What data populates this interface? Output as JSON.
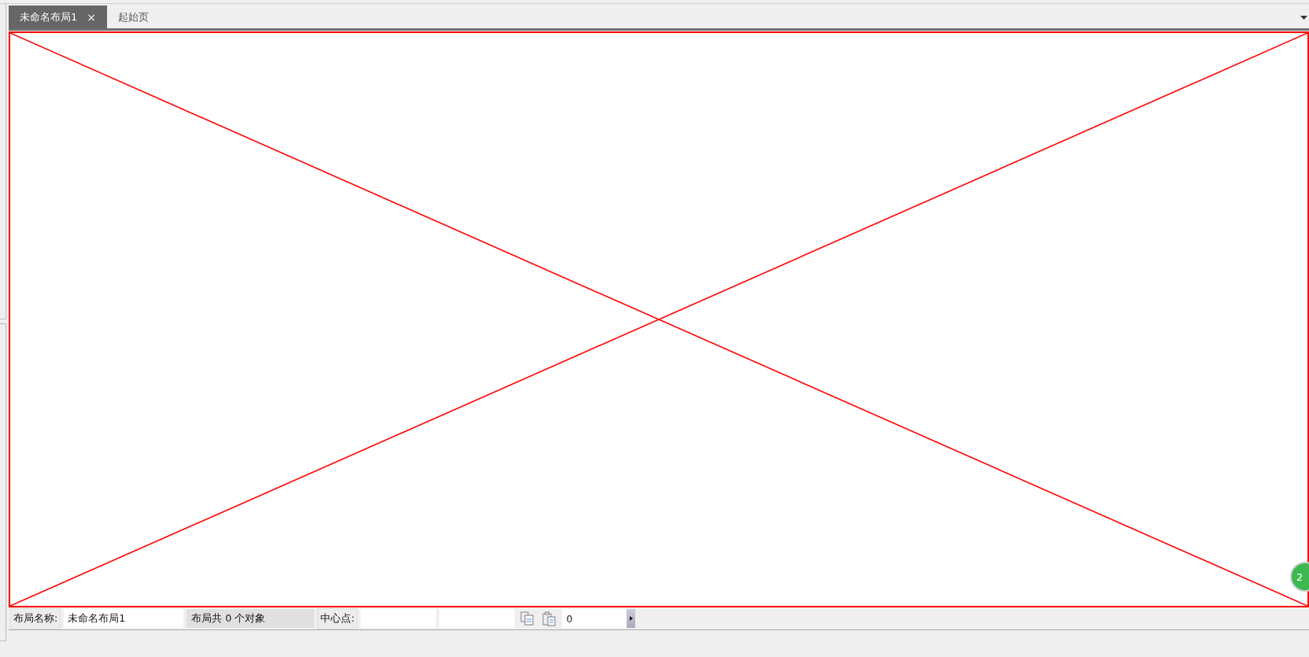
{
  "tabs": [
    {
      "label": "未命名布局1",
      "selected": true,
      "close": "×"
    },
    {
      "label": "起始页",
      "selected": false
    }
  ],
  "status_bar": {
    "name_label": "布局名称:",
    "name_value": "未命名布局1",
    "object_count": "布局共 0 个对象",
    "center_label": "中心点:",
    "number_value": "0"
  },
  "badge": {
    "text": "2"
  }
}
